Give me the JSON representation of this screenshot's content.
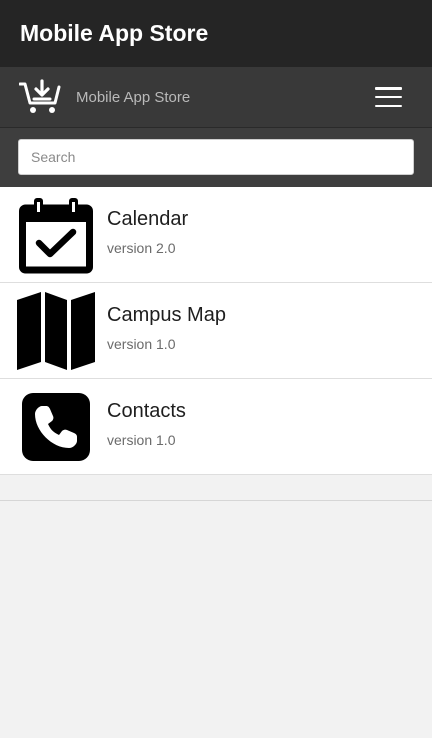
{
  "title_bar": {
    "title": "Mobile App Store"
  },
  "nav_bar": {
    "icon": "cart-download-icon",
    "title": "Mobile App Store",
    "menu_icon": "hamburger-menu-icon"
  },
  "search": {
    "placeholder": "Search",
    "value": ""
  },
  "apps": [
    {
      "name": "Calendar",
      "version": "version 2.0",
      "icon": "calendar-check-icon"
    },
    {
      "name": "Campus Map",
      "version": "version 1.0",
      "icon": "map-icon"
    },
    {
      "name": "Contacts",
      "version": "version 1.0",
      "icon": "phone-icon"
    }
  ],
  "colors": {
    "title_bar_bg": "#252525",
    "nav_bar_bg": "#393939",
    "search_bar_bg": "#3e3e3e",
    "page_bg": "#f2f2f2"
  }
}
